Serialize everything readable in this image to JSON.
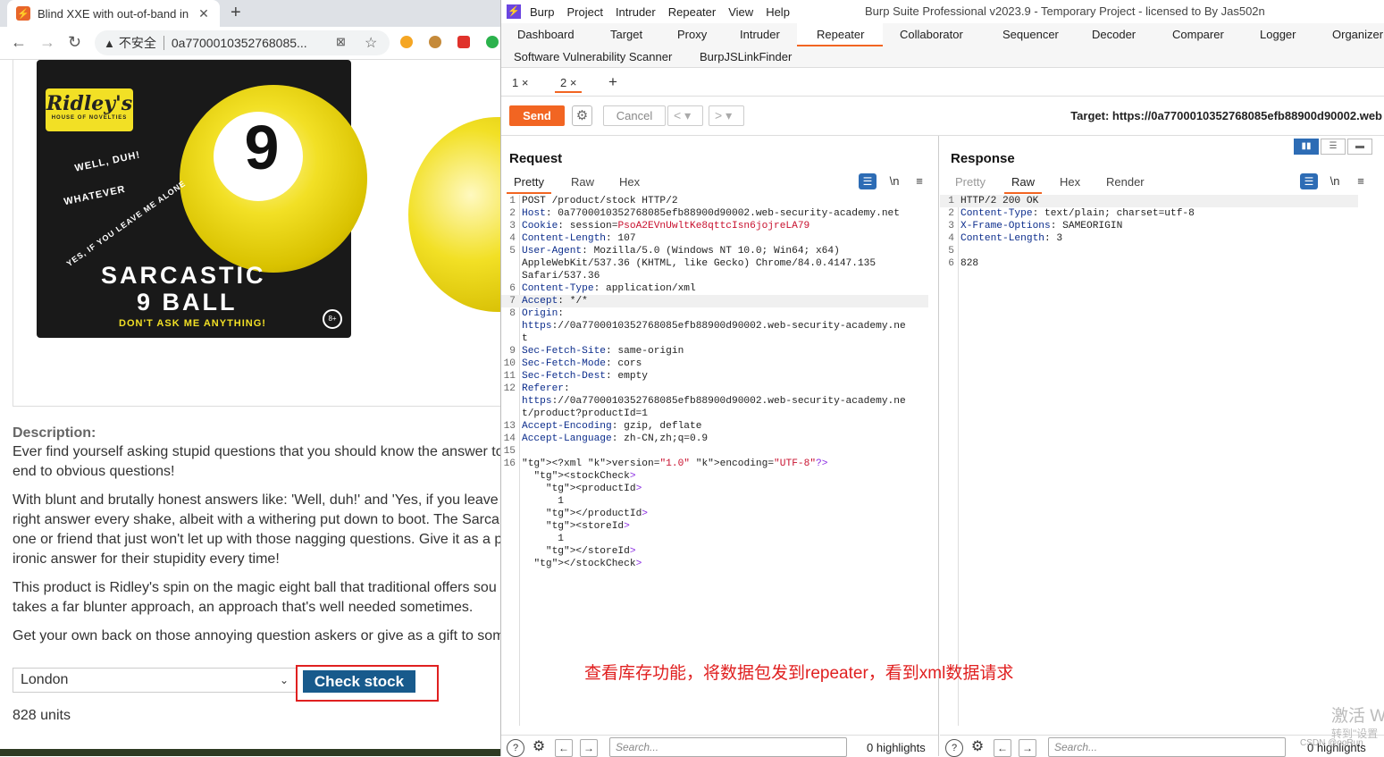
{
  "browser": {
    "tab_title": "Blind XXE with out-of-band in",
    "insecure_label": "不安全",
    "url": "0a7700010352768085..."
  },
  "product": {
    "brand": "Ridley's",
    "brand_sub": "HOUSE OF NOVELTIES",
    "box_line1": "WELL, DUH!",
    "box_line2": "WHATEVER",
    "box_line3": "YES, IF YOU LEAVE ME ALONE",
    "box_title1": "SARCASTIC",
    "box_title2": "9 BALL",
    "box_tagline": "DON'T ASK ME ANYTHING!",
    "ball_number": "9",
    "age_badge": "8+",
    "description_label": "Description:",
    "description_lines": [
      "Ever find yourself asking stupid questions that you should know the answer to",
      "end to obvious questions!",
      "With blunt and brutally honest answers like: 'Well, duh!' and 'Yes, if you leave",
      "right answer every shake, albeit with a withering put down to boot. The Sarca",
      "one or friend that just won't let up with those nagging questions. Give it as a p",
      "ironic answer for their stupidity every time!",
      "This product is Ridley's spin on the magic eight ball that traditional offers sou",
      "takes a far blunter approach, an approach that's well needed sometimes.",
      "Get your own back on those annoying question askers or give as a gift to som"
    ],
    "store_selected": "London",
    "check_stock_label": "Check stock",
    "stock_result": "828 units"
  },
  "burp": {
    "menu": [
      "Burp",
      "Project",
      "Intruder",
      "Repeater",
      "View",
      "Help"
    ],
    "window_title": "Burp Suite Professional v2023.9 - Temporary Project - licensed to By Jas502n",
    "tabs_row1": [
      "Dashboard",
      "Target",
      "Proxy",
      "Intruder",
      "Repeater",
      "Collaborator",
      "Sequencer",
      "Decoder",
      "Comparer",
      "Logger",
      "Organizer"
    ],
    "tabs_row2": [
      "Software Vulnerability Scanner",
      "BurpJSLinkFinder"
    ],
    "active_tab": "Repeater",
    "repeater_tabs": [
      "1 ×",
      "2 ×"
    ],
    "add_tab": "+",
    "send_label": "Send",
    "cancel_label": "Cancel",
    "prev_label": "< ▾",
    "next_label": "> ▾",
    "target_label": "Target: https://0a7700010352768085efb88900d90002.web",
    "request": {
      "title": "Request",
      "views": [
        "Pretty",
        "Raw",
        "Hex"
      ],
      "active_view": "Pretty",
      "search_placeholder": "Search...",
      "highlights": "0 highlights"
    },
    "response": {
      "title": "Response",
      "views": [
        "Pretty",
        "Raw",
        "Hex",
        "Render"
      ],
      "active_view": "Raw",
      "search_placeholder": "Search...",
      "highlights": "0 highlights"
    },
    "request_lines": [
      {
        "n": "1",
        "t": "POST /product/stock HTTP/2"
      },
      {
        "n": "2",
        "t": "Host: 0a7700010352768085efb88900d90002.web-security-academy.net"
      },
      {
        "n": "3",
        "t": "Cookie: session=PsoA2EVnUwltKe8qttcIsn6jojreLA79"
      },
      {
        "n": "4",
        "t": "Content-Length: 107"
      },
      {
        "n": "5",
        "t": "User-Agent: Mozilla/5.0 (Windows NT 10.0; Win64; x64)"
      },
      {
        "n": "",
        "t": "AppleWebKit/537.36 (KHTML, like Gecko) Chrome/84.0.4147.135"
      },
      {
        "n": "",
        "t": "Safari/537.36"
      },
      {
        "n": "6",
        "t": "Content-Type: application/xml"
      },
      {
        "n": "7",
        "t": "Accept: */*"
      },
      {
        "n": "8",
        "t": "Origin:"
      },
      {
        "n": "",
        "t": "https://0a7700010352768085efb88900d90002.web-security-academy.ne"
      },
      {
        "n": "",
        "t": "t"
      },
      {
        "n": "9",
        "t": "Sec-Fetch-Site: same-origin"
      },
      {
        "n": "10",
        "t": "Sec-Fetch-Mode: cors"
      },
      {
        "n": "11",
        "t": "Sec-Fetch-Dest: empty"
      },
      {
        "n": "12",
        "t": "Referer:"
      },
      {
        "n": "",
        "t": "https://0a7700010352768085efb88900d90002.web-security-academy.ne"
      },
      {
        "n": "",
        "t": "t/product?productId=1"
      },
      {
        "n": "13",
        "t": "Accept-Encoding: gzip, deflate"
      },
      {
        "n": "14",
        "t": "Accept-Language: zh-CN,zh;q=0.9"
      },
      {
        "n": "15",
        "t": ""
      },
      {
        "n": "16",
        "t": "<?xml version=\"1.0\" encoding=\"UTF-8\"?>"
      },
      {
        "n": "",
        "t": "  <stockCheck>"
      },
      {
        "n": "",
        "t": "    <productId>"
      },
      {
        "n": "",
        "t": "      1"
      },
      {
        "n": "",
        "t": "    </productId>"
      },
      {
        "n": "",
        "t": "    <storeId>"
      },
      {
        "n": "",
        "t": "      1"
      },
      {
        "n": "",
        "t": "    </storeId>"
      },
      {
        "n": "",
        "t": "  </stockCheck>"
      }
    ],
    "response_lines": [
      {
        "n": "1",
        "t": "HTTP/2 200 OK"
      },
      {
        "n": "2",
        "t": "Content-Type: text/plain; charset=utf-8"
      },
      {
        "n": "3",
        "t": "X-Frame-Options: SAMEORIGIN"
      },
      {
        "n": "4",
        "t": "Content-Length: 3"
      },
      {
        "n": "5",
        "t": ""
      },
      {
        "n": "6",
        "t": "828"
      }
    ]
  },
  "annotation": "查看库存功能，将数据包发到repeater，看到xml数据请求",
  "watermark": {
    "line1": "激活 W",
    "line2": "转到\"设置",
    "line3": "CSDN @ooRun"
  },
  "colors": {
    "burp_orange": "#f26522",
    "check_stock_blue": "#185a8c",
    "annotation_red": "#e02020",
    "header_name_blue": "#0c2d8c",
    "cookie_value_red": "#c8102e"
  }
}
